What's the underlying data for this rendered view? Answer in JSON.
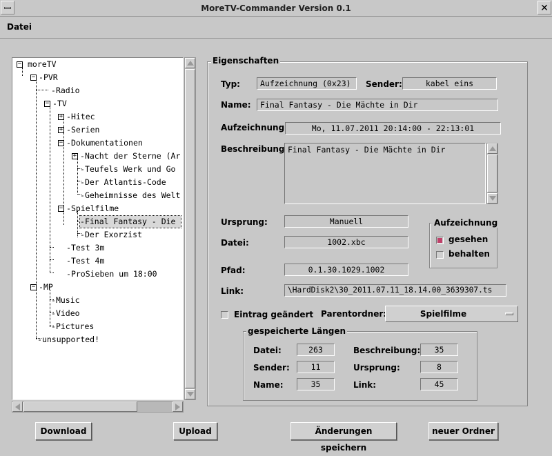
{
  "window": {
    "title": "MoreTV-Commander Version 0.1"
  },
  "menu": {
    "file": "Datei"
  },
  "tree": {
    "root": "moreTV",
    "pvr": "PVR",
    "radio": "Radio",
    "tv": "TV",
    "hitec": "Hitec",
    "serien": "Serien",
    "dokumentationen": "Dokumentationen",
    "doku_1": "Nacht der Sterne (Ar",
    "doku_2": "Teufels Werk und Go",
    "doku_3": "Der Atlantis-Code",
    "doku_4": "Geheimnisse des Welt",
    "spielfilme": "Spielfilme",
    "film_1": "Final Fantasy - Die",
    "film_2": "Der Exorzist",
    "test3m": "Test 3m",
    "test4m": "Test 4m",
    "prosieben": "ProSieben um 18:00",
    "mp": "MP",
    "music": "Music",
    "video": "Video",
    "pictures": "Pictures",
    "unsupported": "unsupported!"
  },
  "props": {
    "legend": "Eigenschaften",
    "typ_label": "Typ:",
    "typ_value": "Aufzeichnung (0x23)",
    "sender_label": "Sender:",
    "sender_value": "kabel eins",
    "name_label": "Name:",
    "name_value": "Final Fantasy - Die Mächte in Dir",
    "aufzeichnung_label": "Aufzeichnung:",
    "aufzeichnung_value": "Mo, 11.07.2011  20:14:00 - 22:13:01",
    "beschreibung_label": "Beschreibung:",
    "beschreibung_value": "Final Fantasy - Die Mächte in Dir",
    "ursprung_label": "Ursprung:",
    "ursprung_value": "Manuell",
    "datei_label": "Datei:",
    "datei_value": "1002.xbc",
    "pfad_label": "Pfad:",
    "pfad_value": "0.1.30.1029.1002",
    "link_label": "Link:",
    "link_value": "\\HardDisk2\\30_2011.07.11_18.14.00_3639307.ts",
    "group_legend": "Aufzeichnung",
    "gesehen": "gesehen",
    "behalten": "behalten",
    "eintrag_geaendert": "Eintrag geändert",
    "parentordner_label": "Parentordner:",
    "parentordner_value": "Spielfilme"
  },
  "lengths": {
    "legend": "gespeicherte Längen",
    "datei_label": "Datei:",
    "datei_value": "263",
    "sender_label": "Sender:",
    "sender_value": "11",
    "name_label": "Name:",
    "name_value": "35",
    "beschreibung_label": "Beschreibung:",
    "beschreibung_value": "35",
    "ursprung_label": "Ursprung:",
    "ursprung_value": "8",
    "link_label": "Link:",
    "link_value": "45"
  },
  "buttons": {
    "download": "Download",
    "upload": "Upload",
    "save": "Änderungen speichern",
    "new_folder": "neuer Ordner"
  },
  "colors": {
    "checked": "#c0406a",
    "background": "#c8c8c8"
  },
  "state": {
    "gesehen_checked": true,
    "behalten_checked": false,
    "eintrag_geaendert_checked": false
  }
}
